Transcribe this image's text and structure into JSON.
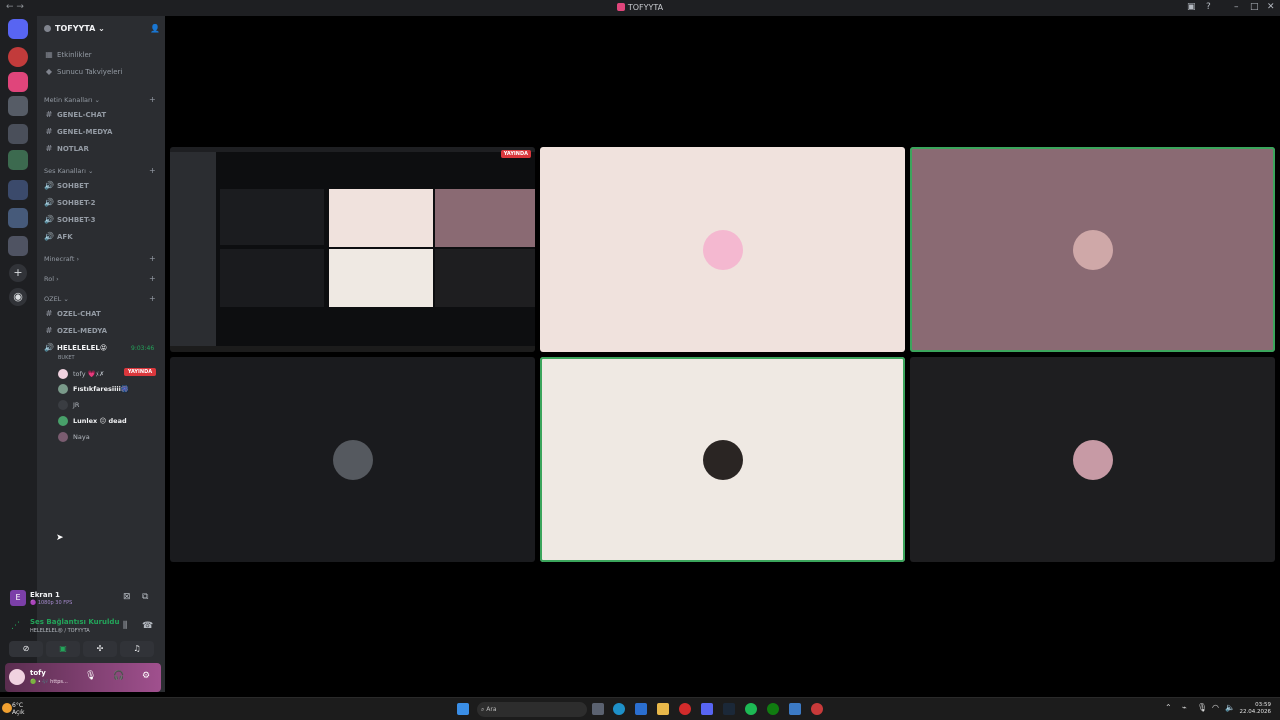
{
  "titlebar": {
    "title": "TOFYYTA",
    "nav": "← →"
  },
  "sidebar": {
    "server_name": "TOFYYTA",
    "chevron": "⌄",
    "invite_icon": "person-plus-icon",
    "top_items": [
      {
        "icon": "calendar-icon",
        "label": "Etkinlikler"
      },
      {
        "icon": "boost-icon",
        "label": "Sunucu Takviyeleri"
      }
    ],
    "categories": {
      "text": "Metin Kanalları ⌄",
      "voice": "Ses Kanalları ⌄",
      "minecraft": "Minecraft ›",
      "rol": "Rol ›",
      "ozel": "OZEL ⌄"
    },
    "text_channels": [
      "GENEL-CHAT",
      "GENEL-MEDYA",
      "NOTLAR"
    ],
    "voice_channels": [
      "SOHBET",
      "SOHBET-2",
      "SOHBET-3",
      "AFK"
    ],
    "ozel_channels": [
      "OZEL-CHAT",
      "OZEL-MEDYA"
    ],
    "active_voice": {
      "name": "HELELELEL😝",
      "timer": "9:03:46",
      "status": "BUKET",
      "members": [
        {
          "name": "tofy 💗ﾒ✗",
          "live": "YAYINDA",
          "color": "#f0d2e0"
        },
        {
          "name": "Fıstıkfaresiiii🎆",
          "color": "#7a9a8a"
        },
        {
          "name": "JR",
          "color": "#3a3d42"
        },
        {
          "name": "Lunlex 😐 dead",
          "color": "#48a06a"
        },
        {
          "name": "Naya",
          "color": "#7a5c70"
        }
      ]
    }
  },
  "stream_panel": {
    "title": "Ekran 1",
    "subtitle": "🟣 1080p 30 FPS",
    "icon_letter": "E",
    "buttons": [
      "stop-stream-icon",
      "popout-icon"
    ]
  },
  "voice_panel": {
    "title": "Ses Bağlantısı Kuruldu",
    "subtitle": "HELELELEL😝 / TOFYYTA",
    "buttons": [
      "noise-suppression-icon",
      "disconnect-icon"
    ]
  },
  "controls": [
    "camera-off-icon",
    "screen-share-icon",
    "activities-icon",
    "soundboard-icon"
  ],
  "user_panel": {
    "name": "tofy",
    "status": "🟢 • 🎶 https...",
    "buttons": [
      "mic-icon",
      "headphones-icon",
      "settings-icon"
    ]
  },
  "stage": {
    "live_label": "YAYINDA",
    "tiles": [
      {
        "type": "screen",
        "bg": "#0d0e10"
      },
      {
        "type": "user",
        "bg": "#f0e2dd",
        "avatar": "#f4b8d0"
      },
      {
        "type": "user",
        "bg": "#8a6a73",
        "avatar": "#cfa8a8",
        "speaking": true
      },
      {
        "type": "user",
        "bg": "#1a1b1e",
        "avatar": "#55595f"
      },
      {
        "type": "user",
        "bg": "#efe9e3",
        "avatar": "#2a2523",
        "speaking": true
      },
      {
        "type": "user",
        "bg": "#1e1e20",
        "avatar": "#c79aa5"
      }
    ]
  },
  "taskbar": {
    "weather_temp": "6°C",
    "weather_text": "Açık",
    "search_placeholder": "Ara",
    "time": "03:59",
    "date": "22.04.2026"
  }
}
